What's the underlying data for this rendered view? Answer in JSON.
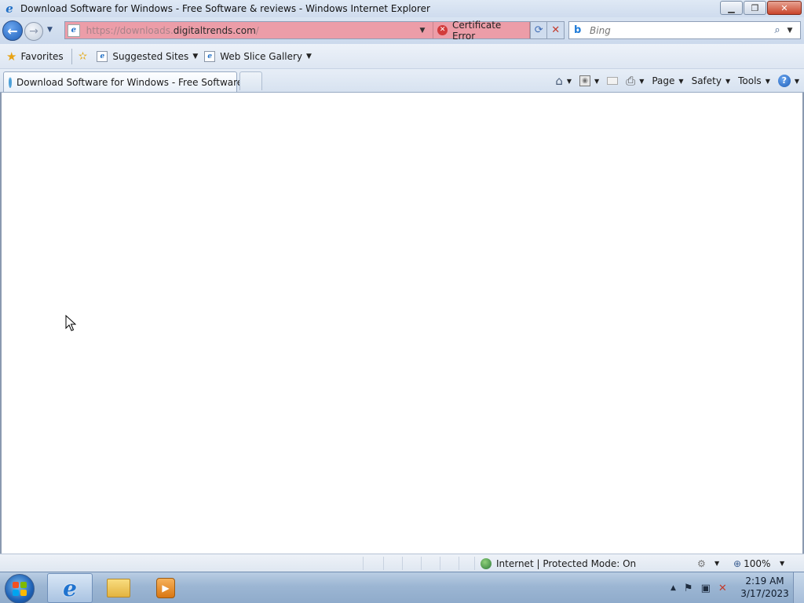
{
  "window": {
    "title": "Download Software for Windows - Free Software & reviews - Windows Internet Explorer",
    "buttons": {
      "minimize": "▁",
      "maximize": "❐",
      "close": "✕"
    }
  },
  "nav": {
    "back": "←",
    "forward": "→",
    "history_drop": "▼",
    "address": {
      "url_prefix": "https://downloads.",
      "url_domain": "digitaltrends.com",
      "url_suffix": "/",
      "dropdown": "▼",
      "certificate_error": "Certificate Error",
      "refresh": "⟳",
      "stop": "✕"
    },
    "search": {
      "icon": "b",
      "placeholder": "Bing",
      "button": "⌕",
      "dropdown": "▼"
    }
  },
  "favorites_bar": {
    "favorites_label": "Favorites",
    "items": [
      {
        "label": "Suggested Sites"
      },
      {
        "label": "Web Slice Gallery"
      }
    ]
  },
  "tabs": [
    {
      "label": "Download Software for Windows - Free Software ..."
    }
  ],
  "command_bar": {
    "page": "Page",
    "safety": "Safety",
    "tools": "Tools",
    "help": "?"
  },
  "status_bar": {
    "zone": "Internet | Protected Mode: On",
    "zoom": "100%"
  },
  "taskbar": {
    "clock_time": "2:19 AM",
    "clock_date": "3/17/2023"
  },
  "colors": {
    "address_error_bg": "#ec9da8",
    "taskbar": "#9cb6d3",
    "accent": "#1f6fc6"
  },
  "icons": [
    "ie-icon",
    "back-icon",
    "forward-icon",
    "page-icon",
    "certificate-error-icon",
    "refresh-icon",
    "stop-icon",
    "bing-icon",
    "search-icon",
    "favorites-star-icon",
    "add-favorites-icon",
    "home-icon",
    "feeds-icon",
    "mail-icon",
    "print-icon",
    "help-icon",
    "globe-icon",
    "zoom-icon",
    "start-icon",
    "ie-taskbar-icon",
    "explorer-folder-icon",
    "media-player-icon",
    "flag-icon",
    "network-icon",
    "volume-muted-icon"
  ]
}
